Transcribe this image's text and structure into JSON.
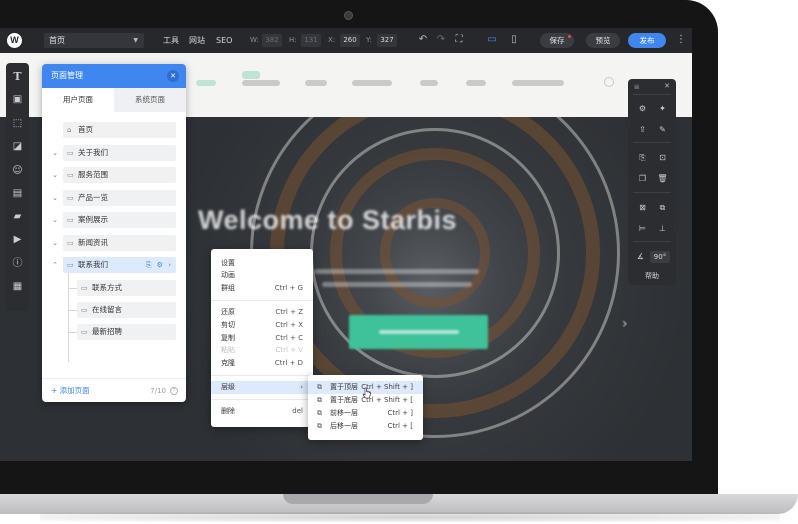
{
  "topbar": {
    "logo_letter": "W",
    "page_select": "首页",
    "menu": [
      "工具",
      "网站",
      "SEO"
    ],
    "coords": [
      {
        "label": "W:",
        "value": "382",
        "dim": true
      },
      {
        "label": "H:",
        "value": "131",
        "dim": true
      },
      {
        "label": "X:",
        "value": "260",
        "dim": false
      },
      {
        "label": "Y:",
        "value": "327",
        "dim": false
      }
    ],
    "save_label": "保存",
    "preview_label": "预览",
    "publish_label": "发布",
    "accent_color": "#3f86ef"
  },
  "canvas": {
    "hero_title": "Welcome to Starbis"
  },
  "left_toolbar": {
    "items": [
      "text-icon",
      "image-icon",
      "cursor-select-icon",
      "shape-icon",
      "emoji-icon",
      "calendar-icon",
      "chat-icon",
      "slideshow-icon",
      "info-icon",
      "widgets-icon"
    ]
  },
  "page_panel": {
    "title": "页面管理",
    "tabs": [
      "用户页面",
      "系统页面"
    ],
    "pages": [
      {
        "label": "首页",
        "icon": "home-icon",
        "expandable": false
      },
      {
        "label": "关于我们",
        "icon": "folder-icon",
        "expandable": true
      },
      {
        "label": "服务范围",
        "icon": "folder-icon",
        "expandable": true
      },
      {
        "label": "产品一览",
        "icon": "folder-icon",
        "expandable": true
      },
      {
        "label": "案例展示",
        "icon": "folder-icon",
        "expandable": true
      },
      {
        "label": "新闻资讯",
        "icon": "folder-icon",
        "expandable": true
      },
      {
        "label": "联系我们",
        "icon": "folder-icon",
        "expandable": true,
        "selected": true,
        "expanded": true
      }
    ],
    "children": [
      {
        "label": "联系方式"
      },
      {
        "label": "在线留言"
      },
      {
        "label": "最新招聘"
      }
    ],
    "add_page_label": "+ 添加页面",
    "page_count": "7/10"
  },
  "context_menu": {
    "items": [
      {
        "label": "设置",
        "shortcut": ""
      },
      {
        "label": "动画",
        "shortcut": ""
      },
      {
        "label": "群组",
        "shortcut": "Ctrl + G"
      },
      {
        "label": "还原",
        "shortcut": "Ctrl + Z"
      },
      {
        "label": "剪切",
        "shortcut": "Ctrl + X"
      },
      {
        "label": "复制",
        "shortcut": "Ctrl + C"
      },
      {
        "label": "粘贴",
        "shortcut": "Ctrl + V",
        "disabled": true
      },
      {
        "label": "克隆",
        "shortcut": "Ctrl + D"
      },
      {
        "label": "层级",
        "shortcut": "›",
        "hover": true
      },
      {
        "label": "删除",
        "shortcut": "del"
      }
    ],
    "layer_submenu": [
      {
        "label": "置于顶层",
        "shortcut": "Ctrl + Shift + ]",
        "hover": true
      },
      {
        "label": "置于底层",
        "shortcut": "Ctrl + Shift + ["
      },
      {
        "label": "前移一层",
        "shortcut": "Ctrl + ]"
      },
      {
        "label": "后移一层",
        "shortcut": "Ctrl + ["
      }
    ]
  },
  "right_panel": {
    "angle_value": "90°",
    "help_label": "帮助"
  }
}
